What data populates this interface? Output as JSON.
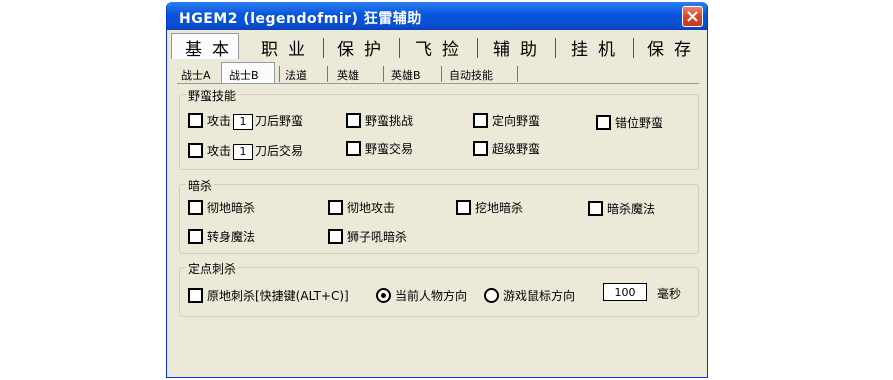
{
  "window": {
    "title": "HGEM2 (legendofmir) 狂雷辅助"
  },
  "main_tabs": [
    "基本",
    "职业",
    "保护",
    "飞捡",
    "辅助",
    "挂机",
    "保存"
  ],
  "sub_tabs": [
    "战士A",
    "战士B",
    "法道",
    "英雄",
    "英雄B",
    "自动技能"
  ],
  "groups": {
    "savage": {
      "title": "野蛮技能",
      "attack1_prefix": "攻击",
      "attack1_value": "1",
      "attack1_suffix": "刀后野蛮",
      "challenge": "野蛮挑战",
      "directed": "定向野蛮",
      "offset": "错位野蛮",
      "attack2_prefix": "攻击",
      "attack2_value": "1",
      "attack2_suffix": "刀后交易",
      "trade": "野蛮交易",
      "super": "超级野蛮"
    },
    "assassin": {
      "title": "暗杀",
      "items": [
        "彻地暗杀",
        "彻地攻击",
        "挖地暗杀",
        "暗杀魔法",
        "转身魔法",
        "狮子吼暗杀"
      ]
    },
    "fixed_thrust": {
      "title": "定点刺杀",
      "in_place": "原地刺杀[快捷键(ALT+C)]",
      "radio_current": "当前人物方向",
      "radio_mouse": "游戏鼠标方向",
      "ms_value": "100",
      "ms_unit": "毫秒"
    }
  }
}
